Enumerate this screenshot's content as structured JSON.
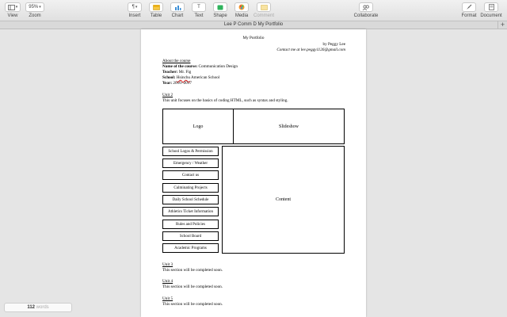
{
  "toolbar": {
    "view": "View",
    "zoom_value": "95%",
    "zoom": "Zoom",
    "insert": "Insert",
    "table": "Table",
    "chart": "Chart",
    "text": "Text",
    "shape": "Shape",
    "media": "Media",
    "comment": "Comment",
    "collaborate": "Collaborate",
    "format": "Format",
    "document": "Document",
    "insert_icon": "¶",
    "text_icon": "T",
    "add_tab": "+"
  },
  "window": {
    "title": "Lee P Comm D My Portfolio"
  },
  "document": {
    "title": "My Portfolio",
    "byline": "by Peggy Lee",
    "contact": "Contact me at lee.peggy1126@gmail.com",
    "about_heading": "About the course",
    "course_label": "Name of the course:",
    "course_value": " Communication Design",
    "teacher_label": "Teacher:",
    "teacher_value": " Mr. Fig",
    "school_label": "School:",
    "school_value_1": "Hsinchu",
    "school_value_2": " American School",
    "year_label": "Year:",
    "year_value": " 2016~2017",
    "unit2_heading": "Unit 2",
    "unit2_text": "This unit focuses on the basics of coding HTML, such as syntax and styling.",
    "wireframe": {
      "logo": "Logo",
      "slideshow": "Slideshow",
      "content": "Content",
      "nav_items": [
        "School Logos & Permission",
        "Emergency / Weather",
        "Contact us",
        "Culminating Projects",
        "Daily School Schedule",
        "Athletics Ticket Information",
        "Rules and Policies",
        "School Board",
        "Academic Programs"
      ]
    },
    "unit3_heading": "Unit 3",
    "unit3_text": "This section will be completed soon.",
    "unit4_heading": "Unit 4",
    "unit4_text": "This section will be completed soon.",
    "unit5_heading": "Unit 5",
    "unit5_text": "This section will be completed soon."
  },
  "status": {
    "word_count": "112",
    "word_label": " words"
  }
}
